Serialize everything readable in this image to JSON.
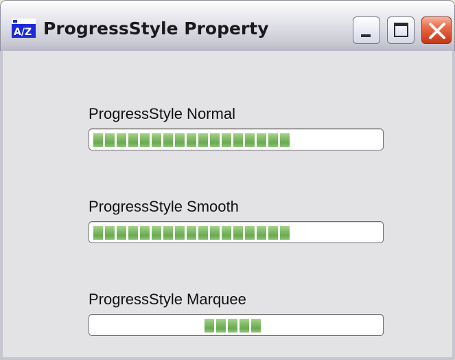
{
  "window": {
    "title": "ProgressStyle Property",
    "icon": "app-icon",
    "controls": [
      "minimize-icon",
      "maximize-icon",
      "close-icon"
    ]
  },
  "progress_bars": [
    {
      "label": "ProgressStyle Normal",
      "style": "blocks",
      "value_percent": 72,
      "block_count": 17
    },
    {
      "label": "ProgressStyle Smooth",
      "style": "blocks",
      "value_percent": 72,
      "block_count": 17
    },
    {
      "label": "ProgressStyle Marquee",
      "style": "marquee",
      "block_count": 5,
      "marquee_position_percent": 40
    }
  ],
  "colors": {
    "client_bg": "#e3e3e6",
    "progress_fill": "#7fbb63",
    "progress_border": "#6b6b6b",
    "close_button": "#d44a26"
  }
}
